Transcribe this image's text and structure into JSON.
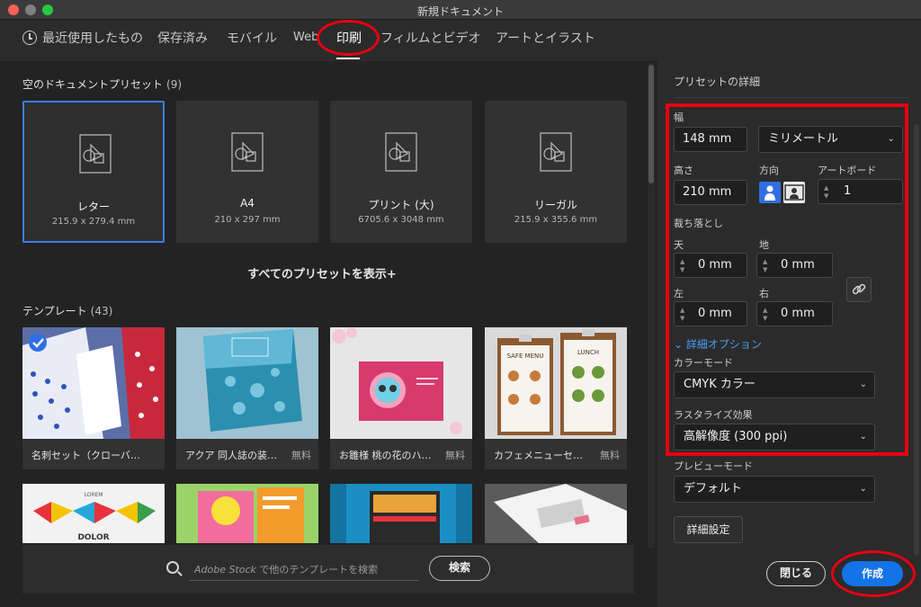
{
  "window": {
    "title": "新規ドキュメント"
  },
  "tabs": [
    {
      "label": "最近使用したもの"
    },
    {
      "label": "保存済み"
    },
    {
      "label": "モバイル"
    },
    {
      "label": "Web"
    },
    {
      "label": "印刷",
      "active": true
    },
    {
      "label": "フィルムとビデオ"
    },
    {
      "label": "アートとイラスト"
    }
  ],
  "presets": {
    "title": "空のドキュメントプリセット",
    "count": "(9)",
    "items": [
      {
        "name": "レター",
        "size": "215.9 x 279.4 mm",
        "selected": true
      },
      {
        "name": "A4",
        "size": "210 x 297 mm"
      },
      {
        "name": "プリント (大)",
        "size": "6705.6 x 3048 mm"
      },
      {
        "name": "リーガル",
        "size": "215.9 x 355.6 mm"
      }
    ],
    "show_all": "すべてのプリセットを表示+"
  },
  "templates": {
    "title": "テンプレート",
    "count": "(43)",
    "items": [
      {
        "name": "名刺セット（クローバ…",
        "badge": ""
      },
      {
        "name": "アクア 同人誌の装…",
        "badge": "無料"
      },
      {
        "name": "お雛様 桃の花のハ…",
        "badge": "無料"
      },
      {
        "name": "カフェメニューセ…",
        "badge": "無料"
      }
    ],
    "thumb_text": {
      "lorem": "LOREM",
      "dolor": "DOLOR",
      "safe_menu": "SAFE MENU",
      "lunch": "LUNCH"
    }
  },
  "search": {
    "placeholder_stock": "Adobe Stock",
    "placeholder_rest": " で他のテンプレートを検索",
    "button": "検索"
  },
  "details": {
    "title": "プリセットの詳細",
    "width_label": "幅",
    "width_value": "148 mm",
    "unit": "ミリメートル",
    "height_label": "高さ",
    "height_value": "210 mm",
    "orientation_label": "方向",
    "artboard_label": "アートボード",
    "artboard_value": "1",
    "bleed_label": "裁ち落とし",
    "bleed_top_label": "天",
    "bleed_top": "0 mm",
    "bleed_bottom_label": "地",
    "bleed_bottom": "0 mm",
    "bleed_left_label": "左",
    "bleed_left": "0 mm",
    "bleed_right_label": "右",
    "bleed_right": "0 mm",
    "advanced_toggle": "詳細オプション",
    "color_mode_label": "カラーモード",
    "color_mode": "CMYK カラー",
    "raster_label": "ラスタライズ効果",
    "raster": "高解像度 (300 ppi)",
    "preview_label": "プレビューモード",
    "preview": "デフォルト",
    "advanced_button": "詳細設定",
    "close_button": "閉じる",
    "create_button": "作成"
  },
  "colors": {
    "accent": "#1473e6",
    "selection": "#3d7df0",
    "annotation": "#e60012",
    "panel": "#2b2b2b",
    "background": "#232323"
  }
}
